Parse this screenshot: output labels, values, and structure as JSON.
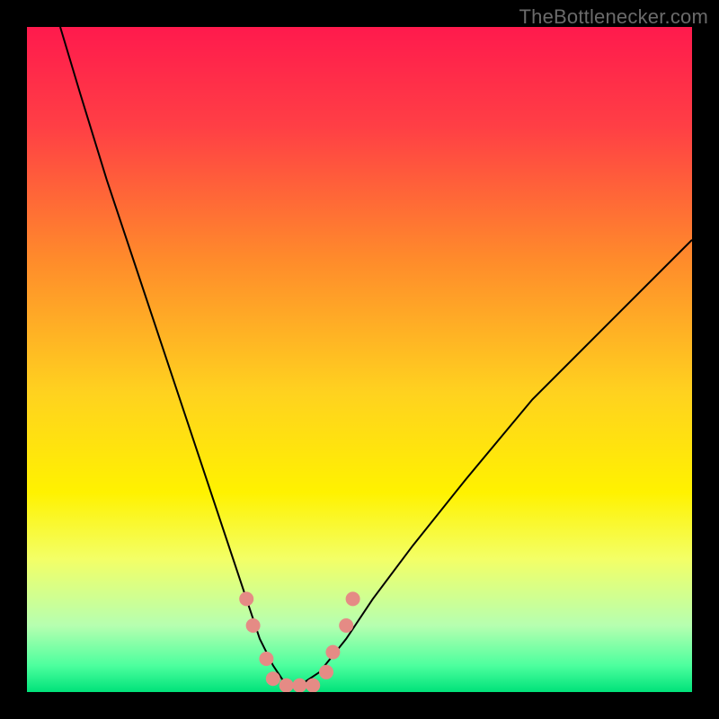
{
  "watermark": "TheBottlenecker.com",
  "chart_data": {
    "type": "line",
    "title": "",
    "xlabel": "",
    "ylabel": "",
    "xlim": [
      0,
      100
    ],
    "ylim": [
      0,
      100
    ],
    "background": {
      "type": "vertical-gradient",
      "stops": [
        {
          "pos": 0.0,
          "color": "#ff1a4d"
        },
        {
          "pos": 0.15,
          "color": "#ff3f45"
        },
        {
          "pos": 0.35,
          "color": "#ff8b2b"
        },
        {
          "pos": 0.55,
          "color": "#ffd21f"
        },
        {
          "pos": 0.7,
          "color": "#fff200"
        },
        {
          "pos": 0.8,
          "color": "#f3ff66"
        },
        {
          "pos": 0.9,
          "color": "#b6ffb0"
        },
        {
          "pos": 0.96,
          "color": "#4dff9e"
        },
        {
          "pos": 1.0,
          "color": "#00e27a"
        }
      ]
    },
    "series": [
      {
        "name": "bottleneck-curve",
        "color": "#000000",
        "width": 2,
        "x": [
          5,
          8,
          12,
          16,
          20,
          24,
          28,
          31,
          33,
          35,
          37,
          39,
          41,
          44,
          48,
          52,
          58,
          66,
          76,
          88,
          100
        ],
        "y": [
          100,
          90,
          77,
          65,
          53,
          41,
          29,
          20,
          14,
          8,
          4,
          1,
          1,
          3,
          8,
          14,
          22,
          32,
          44,
          56,
          68
        ]
      }
    ],
    "markers": {
      "name": "highlight-dots",
      "color": "#e58b85",
      "radius": 8,
      "points": [
        {
          "x": 33,
          "y": 14
        },
        {
          "x": 34,
          "y": 10
        },
        {
          "x": 36,
          "y": 5
        },
        {
          "x": 37,
          "y": 2
        },
        {
          "x": 39,
          "y": 1
        },
        {
          "x": 41,
          "y": 1
        },
        {
          "x": 43,
          "y": 1
        },
        {
          "x": 45,
          "y": 3
        },
        {
          "x": 46,
          "y": 6
        },
        {
          "x": 48,
          "y": 10
        },
        {
          "x": 49,
          "y": 14
        }
      ]
    }
  }
}
